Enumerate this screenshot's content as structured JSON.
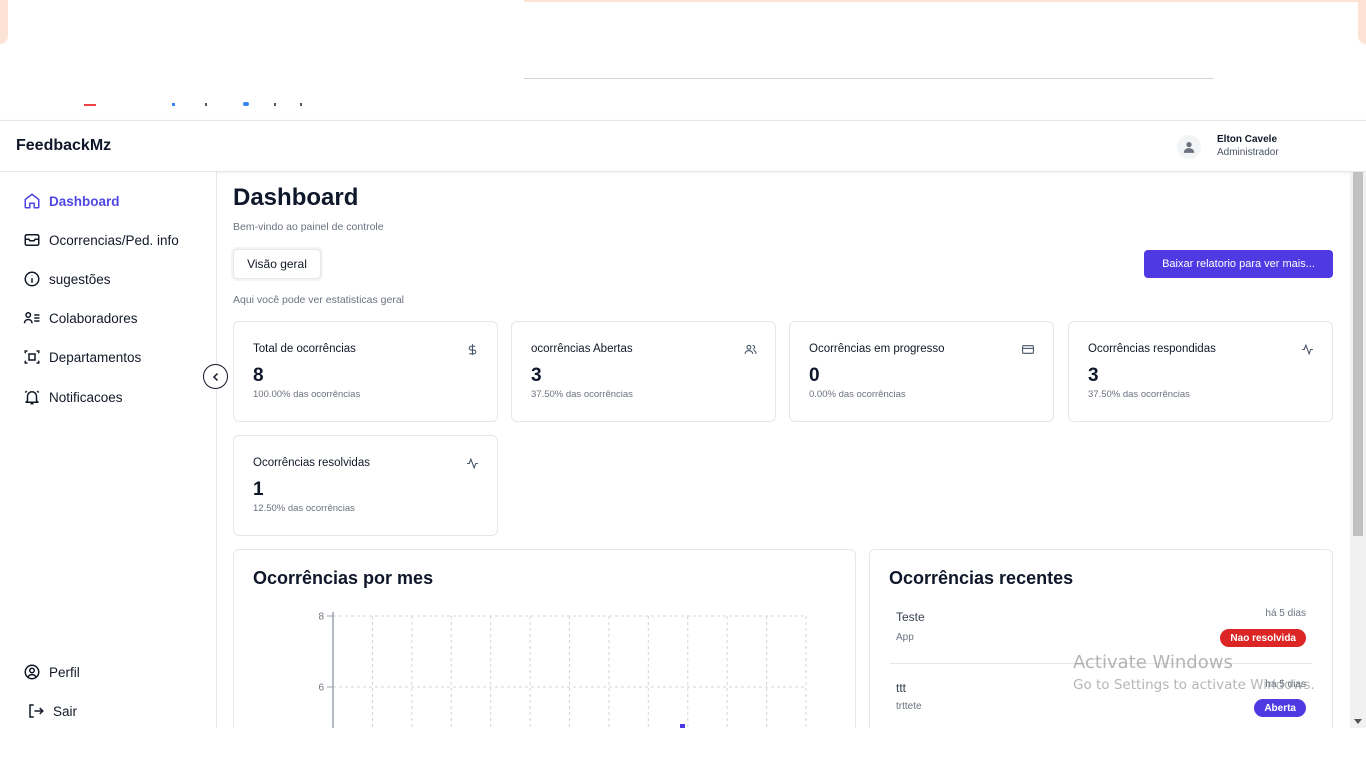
{
  "header": {
    "brand": "FeedbackMz",
    "user_name": "Elton Cavele",
    "user_role": "Administrador"
  },
  "sidebar": {
    "items": [
      {
        "label": "Dashboard",
        "icon": "home-icon",
        "active": true
      },
      {
        "label": "Ocorrencias/Ped. info",
        "icon": "inbox-icon",
        "active": false
      },
      {
        "label": "sugestões",
        "icon": "info-icon",
        "active": false
      },
      {
        "label": "Colaboradores",
        "icon": "users-list-icon",
        "active": false
      },
      {
        "label": "Departamentos",
        "icon": "building-scan-icon",
        "active": false
      },
      {
        "label": "Notificacoes",
        "icon": "bell-icon",
        "active": false
      }
    ],
    "bottom": [
      {
        "label": "Perfil",
        "icon": "user-circle-icon"
      },
      {
        "label": "Sair",
        "icon": "logout-icon"
      }
    ]
  },
  "main": {
    "title": "Dashboard",
    "subtitle": "Bem-vindo ao painel de controle",
    "tab": "Visão geral",
    "tab_description": "Aqui você pode ver estatisticas geral",
    "download_button": "Baixar relatorio para ver mais..."
  },
  "stats": [
    {
      "label": "Total de ocorrências",
      "value": "8",
      "percent": "100.00% das ocorrências",
      "icon": "dollar-icon"
    },
    {
      "label": "ocorrências Abertas",
      "value": "3",
      "percent": "37.50% das ocorrências",
      "icon": "users-icon"
    },
    {
      "label": "Ocorrências em progresso",
      "value": "0",
      "percent": "0.00% das ocorrências",
      "icon": "credit-card-icon"
    },
    {
      "label": "Ocorrências respondidas",
      "value": "3",
      "percent": "37.50% das ocorrências",
      "icon": "activity-icon"
    },
    {
      "label": "Ocorrências resolvidas",
      "value": "1",
      "percent": "12.50% das ocorrências",
      "icon": "activity-icon"
    }
  ],
  "chart_panel": {
    "title": "Ocorrências por mes"
  },
  "chart_data": {
    "type": "bar",
    "title": "Ocorrências por mes",
    "y_ticks": [
      "8",
      "6"
    ],
    "ylim": [
      0,
      8
    ],
    "grid": true
  },
  "recent": {
    "title": "Ocorrências recentes",
    "items": [
      {
        "title": "Teste",
        "sub": "App",
        "time": "há 5 dias",
        "status": "Nao resolvida",
        "status_color": "#dc2626"
      },
      {
        "title": "ttt",
        "sub": "trttete",
        "time": "há 5 dias",
        "status": "Aberta",
        "status_color": "#4f39e3"
      }
    ]
  },
  "watermark": {
    "line1": "Activate Windows",
    "line2": "Go to Settings to activate Windows."
  },
  "colors": {
    "accent": "#4f39e3",
    "danger": "#dc2626"
  }
}
